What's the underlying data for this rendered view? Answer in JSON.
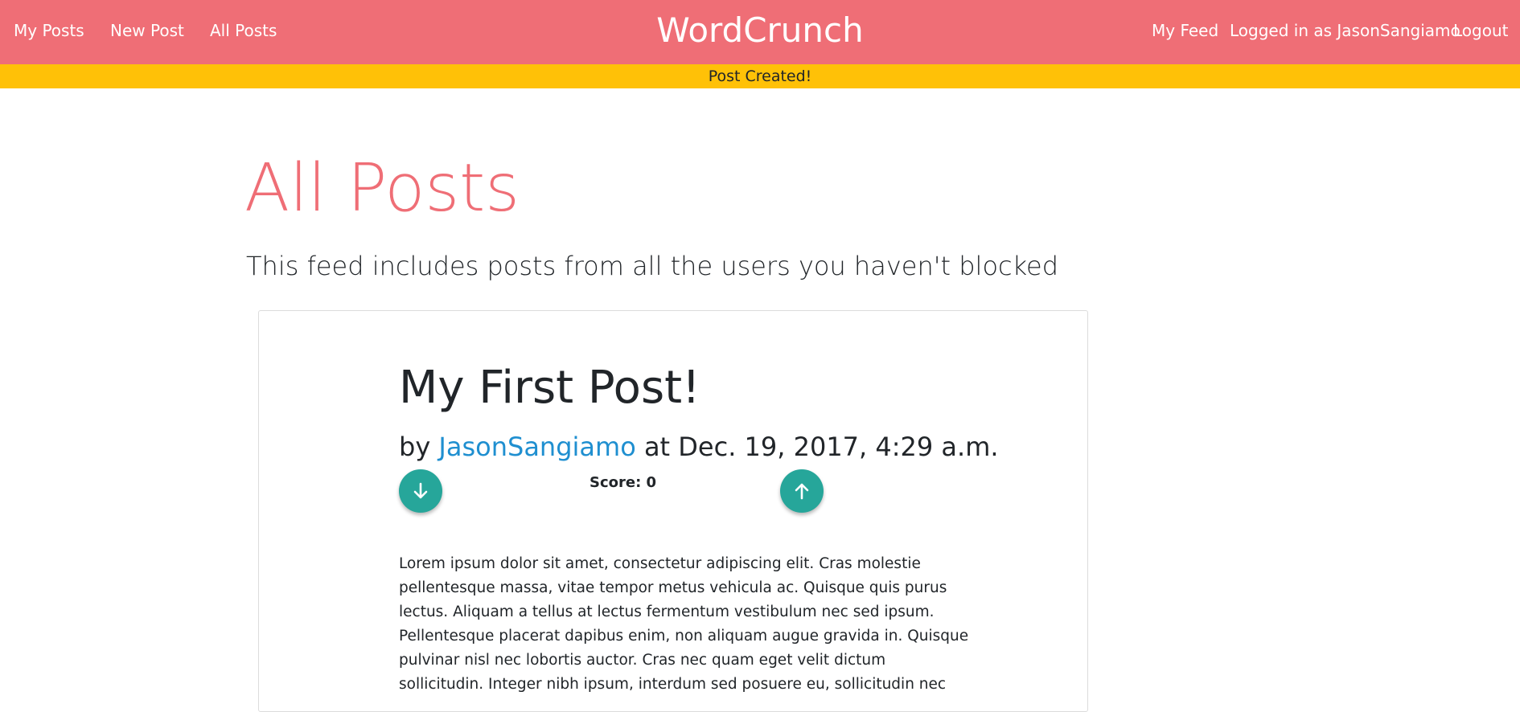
{
  "nav": {
    "left_links": [
      "My Posts",
      "New Post",
      "All Posts"
    ],
    "brand": "WordCrunch",
    "right_links": [
      "My Feed",
      "Logged in as JasonSangiamo",
      "Logout"
    ]
  },
  "alert": {
    "message": "Post Created!"
  },
  "page": {
    "title": "All Posts",
    "subtitle": "This feed includes posts from all the users you haven't blocked"
  },
  "post": {
    "title": "My First Post!",
    "by_prefix": "by",
    "author": "JasonSangiamo",
    "at_prefix": "at",
    "date": "Dec. 19, 2017, 4:29 a.m.",
    "score_text": "Score: 0",
    "downvote_icon": "arrow-down-icon",
    "upvote_icon": "arrow-up-icon",
    "body": "Lorem ipsum dolor sit amet, consectetur adipiscing elit. Cras molestie pellentesque massa, vitae tempor metus vehicula ac. Quisque quis purus lectus. Aliquam a tellus at lectus fermentum vestibulum nec sed ipsum. Pellentesque placerat dapibus enim, non aliquam augue gravida in. Quisque pulvinar nisl nec lobortis auctor. Cras nec quam eget velit dictum sollicitudin. Integer nibh ipsum, interdum sed posuere eu, sollicitudin nec"
  },
  "colors": {
    "navbar": "#ef6e76",
    "alert": "#ffc107",
    "title": "#ef6e76",
    "vote_button": "#26a69a",
    "author_link": "#1f8fd0"
  }
}
